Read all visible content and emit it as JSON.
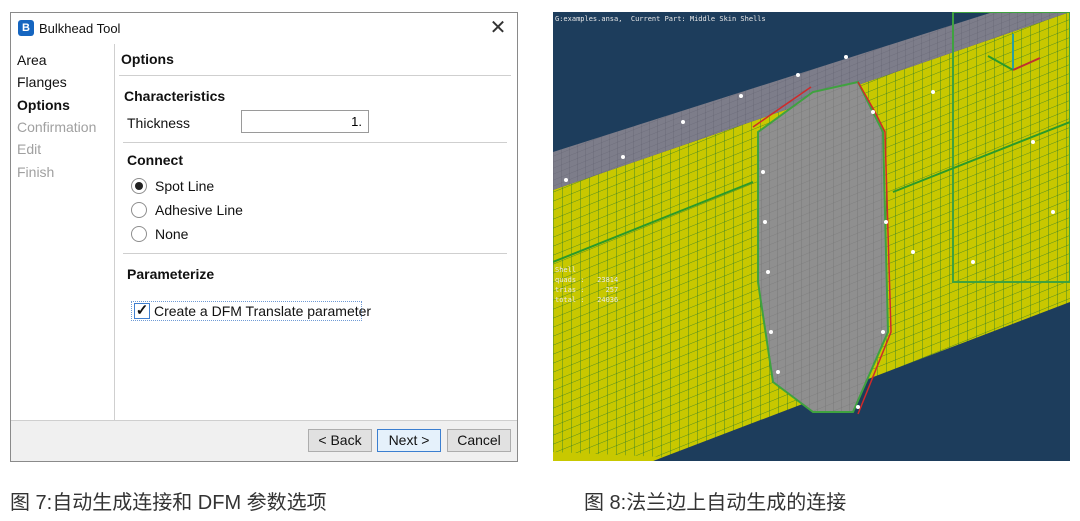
{
  "dialog": {
    "title": "Bulkhead Tool",
    "close_label": "✕",
    "app_icon_letter": "B",
    "steps": [
      "Area",
      "Flanges",
      "Options",
      "Confirmation",
      "Edit",
      "Finish"
    ],
    "active_step": "Options",
    "panel_title": "Options",
    "characteristics": {
      "title": "Characteristics",
      "thickness_label": "Thickness",
      "thickness_value": "1."
    },
    "connect": {
      "title": "Connect",
      "options": [
        "Spot Line",
        "Adhesive Line",
        "None"
      ],
      "selected": "Spot Line"
    },
    "parameterize": {
      "title": "Parameterize",
      "checkbox_label": "Create a DFM Translate parameter",
      "checked": true
    },
    "buttons": {
      "back": "< Back",
      "next": "Next >",
      "cancel": "Cancel"
    }
  },
  "viewport": {
    "header_text": "G:examples.ansa,  Current Part: Middle Skin Shells",
    "stats": [
      "Shell",
      "quads :   23814",
      "trias :     257",
      "total :   24036"
    ],
    "colors": {
      "background": "#1d3d5c",
      "shell": "#c8c800",
      "mesh_lines": "#2a7a2a",
      "bulkhead": "#8f8f8f",
      "edge": "#d02a2a"
    }
  },
  "captions": {
    "left": "图 7:自动生成连接和 DFM 参数选项",
    "right": "图 8:法兰边上自动生成的连接"
  }
}
